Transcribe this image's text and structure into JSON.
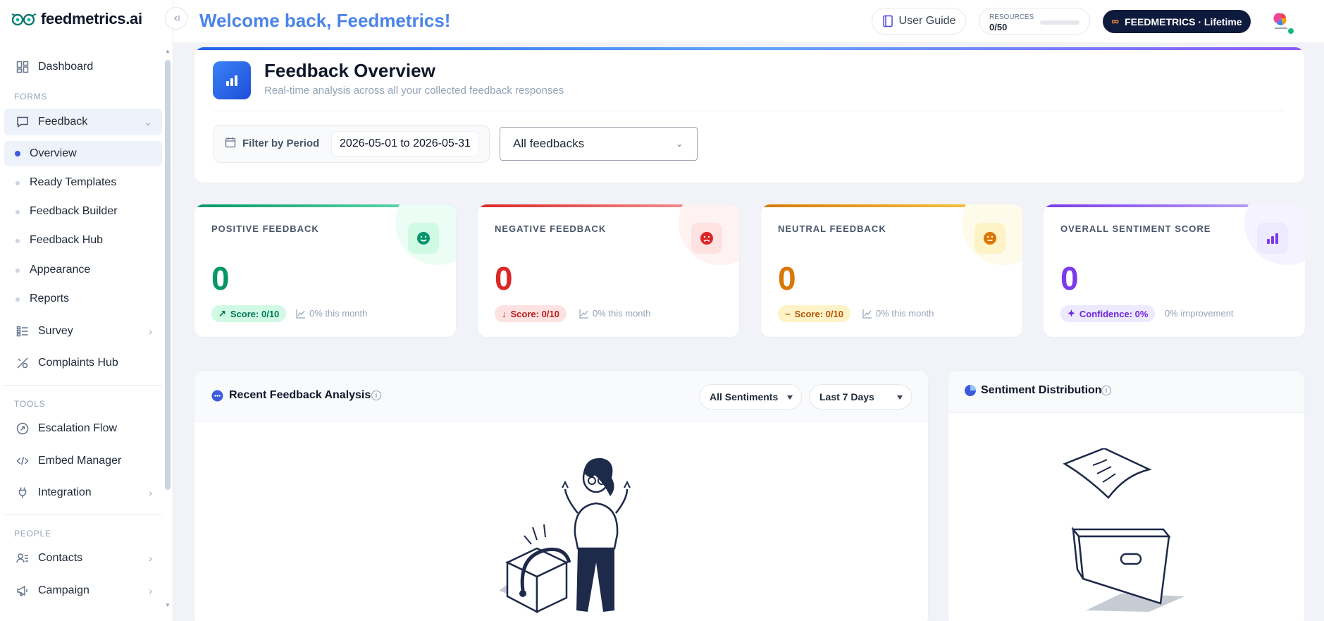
{
  "brand": {
    "name": "feedmetrics.ai"
  },
  "sidebar": {
    "dashboard": "Dashboard",
    "forms_label": "FORMS",
    "feedback": "Feedback",
    "feedback_subitems": [
      "Overview",
      "Ready Templates",
      "Feedback Builder",
      "Feedback Hub",
      "Appearance",
      "Reports"
    ],
    "survey": "Survey",
    "complaints_hub": "Complaints Hub",
    "tools_label": "TOOLS",
    "escalation_flow": "Escalation Flow",
    "embed_manager": "Embed Manager",
    "integration": "Integration",
    "people_label": "PEOPLE",
    "contacts": "Contacts",
    "campaign": "Campaign"
  },
  "header": {
    "welcome": "Welcome back, Feedmetrics!",
    "user_guide": "User Guide",
    "resources_label": "RESOURCES",
    "resources_value": "0/50",
    "resources_fraction": 0.0,
    "plan_label": "FEEDMETRICS · Lifetime"
  },
  "overview": {
    "title": "Feedback Overview",
    "subtitle": "Real-time analysis across all your collected feedback responses",
    "filter_label": "Filter by Period",
    "date_range": "2026-05-01 to 2026-05-31",
    "select_value": "All feedbacks"
  },
  "stats": [
    {
      "label": "POSITIVE FEEDBACK",
      "value": "0",
      "pill": "Score: 0/10",
      "trend": "0% this month",
      "color": "#059669",
      "icon": "smile-icon"
    },
    {
      "label": "NEGATIVE FEEDBACK",
      "value": "0",
      "pill": "Score: 0/10",
      "trend": "0% this month",
      "color": "#dc2626",
      "icon": "frown-icon"
    },
    {
      "label": "NEUTRAL FEEDBACK",
      "value": "0",
      "pill": "Score: 0/10",
      "trend": "0% this month",
      "color": "#d97706",
      "icon": "neutral-face-icon"
    },
    {
      "label": "OVERALL SENTIMENT SCORE",
      "value": "0",
      "pill": "Confidence: 0%",
      "trend": "0% improvement",
      "color": "#7c3aed",
      "icon": "bar-chart-icon"
    }
  ],
  "recent": {
    "title": "Recent Feedback Analysis",
    "sentiment_filter": "All Sentiments",
    "period_filter": "Last 7 Days"
  },
  "distribution": {
    "title": "Sentiment Distribution"
  },
  "colors": {
    "accent": "#4a84e8",
    "plan_bg": "#0f1b3d",
    "online": "#10b981"
  }
}
